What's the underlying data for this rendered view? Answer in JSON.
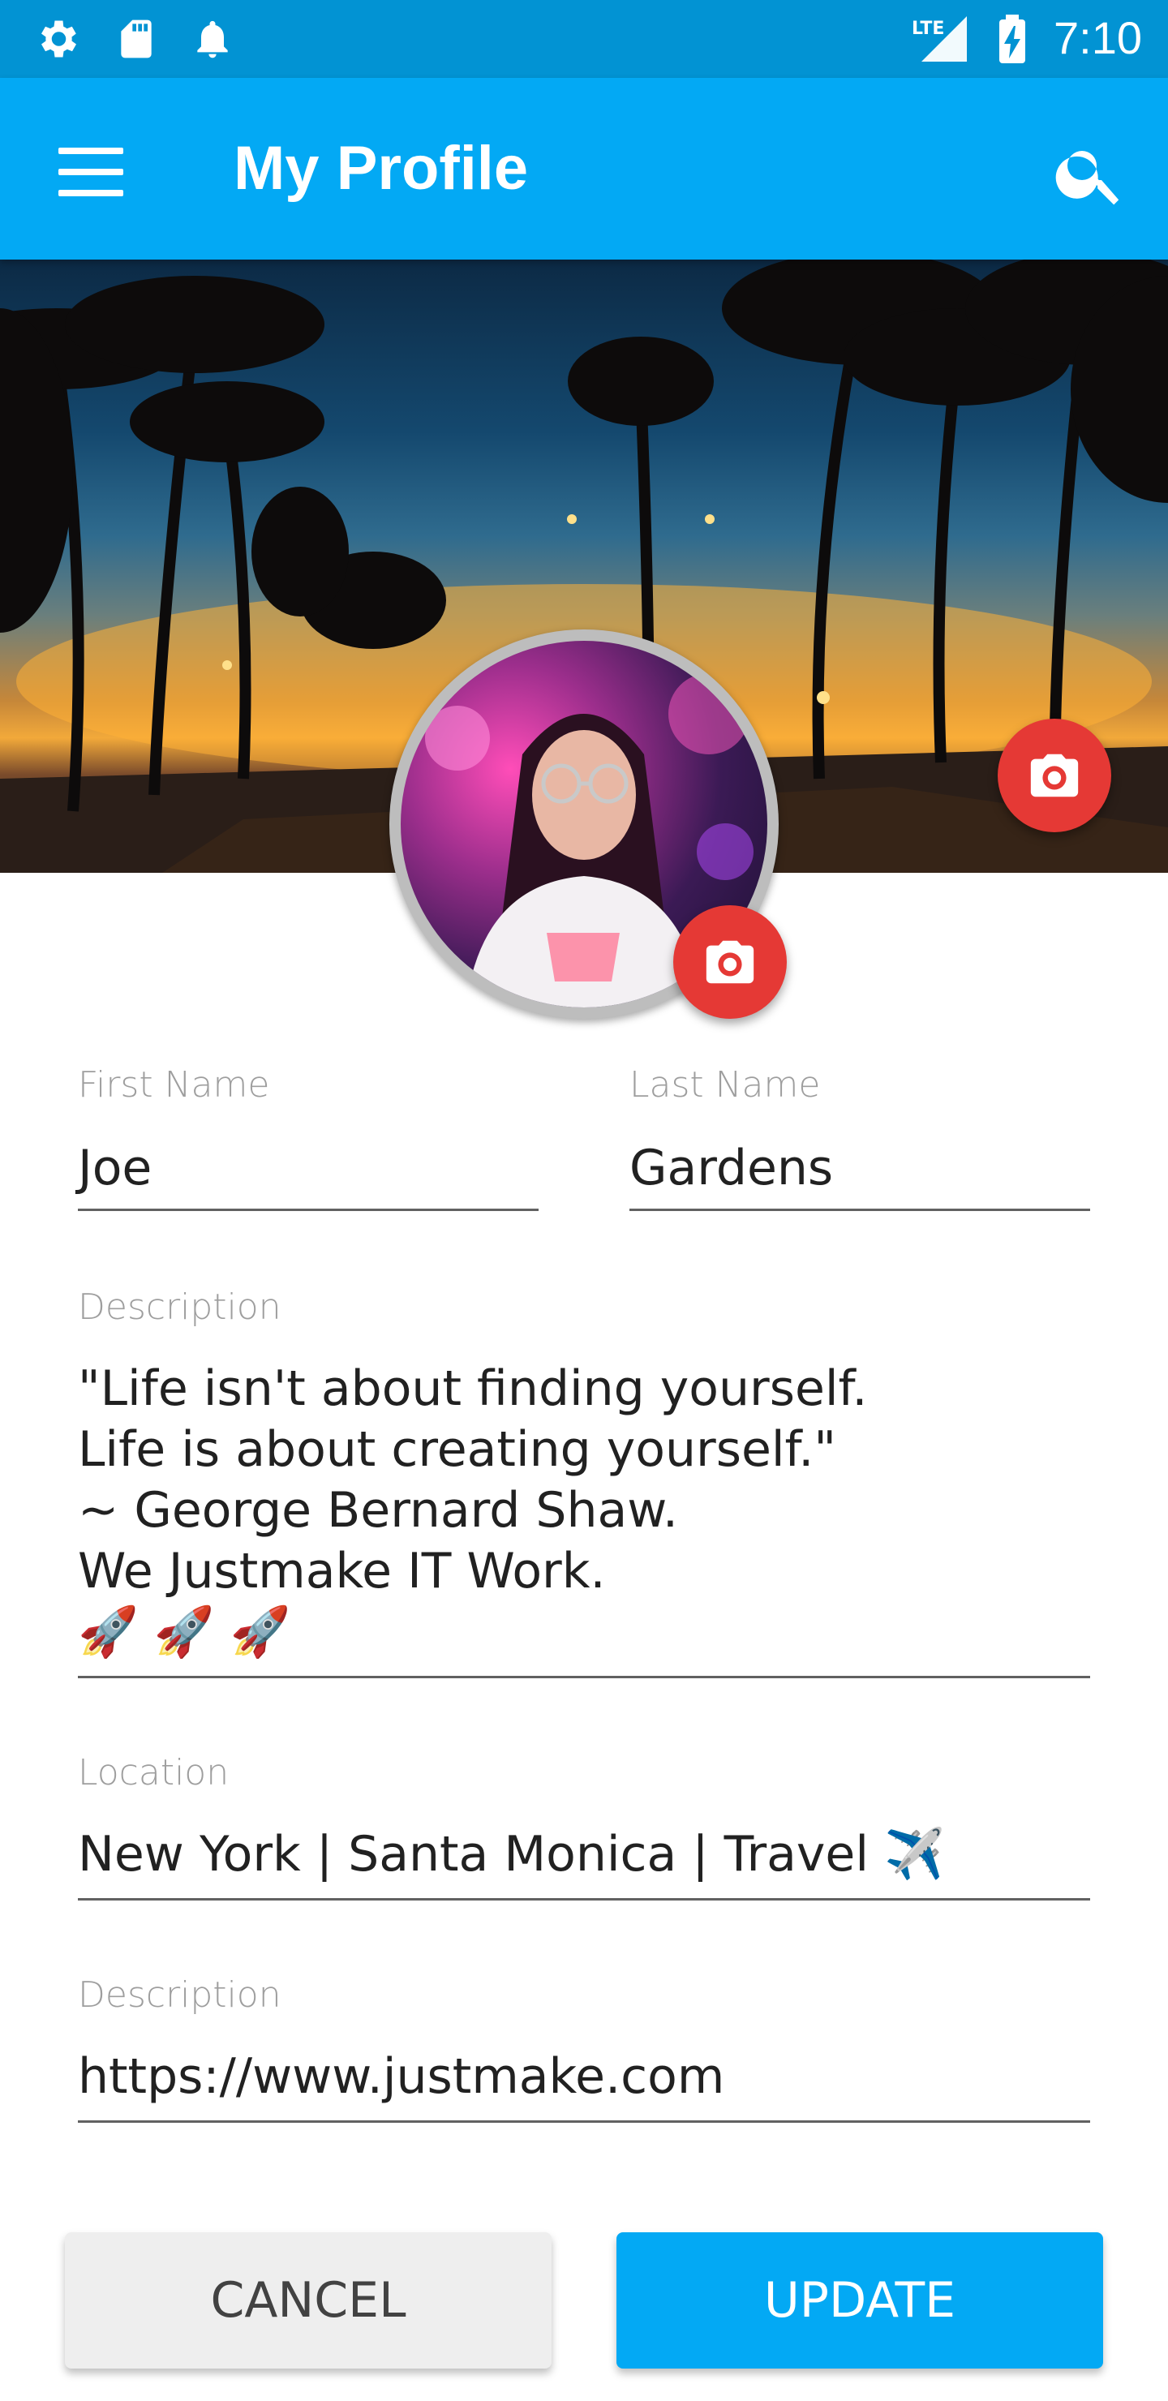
{
  "status_bar": {
    "time": "7:10",
    "network": "LTE",
    "icons": [
      "settings-icon",
      "sd-card-icon",
      "notification-bell-icon",
      "lte-signal-icon",
      "battery-charging-icon"
    ]
  },
  "app_bar": {
    "title": "My Profile",
    "icons": [
      "menu-icon",
      "search-icon"
    ],
    "color": "#03a9f4"
  },
  "profile": {
    "first_name": {
      "label": "First Name",
      "value": "Joe"
    },
    "last_name": {
      "label": "Last Name",
      "value": "Gardens"
    },
    "description": {
      "label": "Description",
      "value": "\"Life isn't about finding yourself.\nLife is about creating yourself.\"\n~ George Bernard Shaw.\nWe Justmake IT Work.\n🚀 🚀 🚀"
    },
    "location": {
      "label": "Location",
      "value": "New York | Santa Monica | Travel ✈️"
    },
    "website": {
      "label": "Description",
      "value": "https://www.justmake.com"
    }
  },
  "actions": {
    "cancel_label": "CANCEL",
    "update_label": "UPDATE"
  },
  "colors": {
    "fab": "#e53935",
    "status_bar": "#0293d3"
  }
}
